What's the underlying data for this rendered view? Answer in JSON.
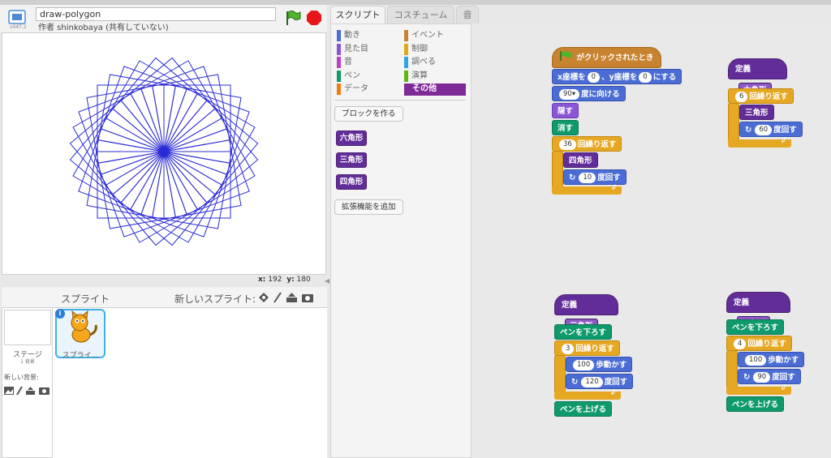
{
  "project": {
    "title": "draw-polygon",
    "author": "作者 shinkobaya (共有していない)",
    "version": "v447.2"
  },
  "stage": {
    "coords_x_label": "x:",
    "coords_x": "192",
    "coords_y_label": "y:",
    "coords_y": "180",
    "drawing": {
      "squares": 36,
      "rotation_step_deg": 10,
      "color": "#2b2bd6"
    }
  },
  "sprite_pane": {
    "label": "スプライト",
    "new_sprite_label": "新しいスプライト:",
    "stage_label": "ステージ",
    "stage_sub": "1 背景",
    "new_backdrop_label": "新しい背景:",
    "sprite_name": "スプライ..."
  },
  "tabs": {
    "script": "スクリプト",
    "costume": "コスチューム",
    "sound": "音"
  },
  "palette": {
    "categories": [
      {
        "label": "動き",
        "color": "#4a6cd4"
      },
      {
        "label": "見た目",
        "color": "#8a55d7"
      },
      {
        "label": "音",
        "color": "#bb42c3"
      },
      {
        "label": "ペン",
        "color": "#0e9a6c"
      },
      {
        "label": "データ",
        "color": "#ee7d16"
      },
      {
        "label": "イベント",
        "color": "#c88330"
      },
      {
        "label": "制御",
        "color": "#e1a91a"
      },
      {
        "label": "調べる",
        "color": "#2ca5e2"
      },
      {
        "label": "演算",
        "color": "#5cb712"
      },
      {
        "label": "その他",
        "color": "#632d99"
      }
    ],
    "make_block": "ブロックを作る",
    "custom_blocks": [
      "六角形",
      "三角形",
      "四角形"
    ],
    "add_extension": "拡張機能を追加"
  },
  "scripts": {
    "main": {
      "hat": "がクリックされたとき",
      "goto_a": "x座標を",
      "goto_x": "0",
      "goto_b": "、y座標を",
      "goto_y": "0",
      "goto_c": "にする",
      "point_val": "90▾",
      "point_label": "度に向ける",
      "hide": "隠す",
      "clear": "消す",
      "repeat_n": "36",
      "repeat_label": "回繰り返す",
      "call": "四角形",
      "turn_val": "10",
      "turn_label": "度回す"
    },
    "hexagon": {
      "def_label": "定義",
      "name": "六角形",
      "repeat_n": "6",
      "repeat_label": "回繰り返す",
      "call": "三角形",
      "turn_val": "60",
      "turn_label": "度回す"
    },
    "triangle": {
      "def_label": "定義",
      "name": "三角形",
      "pen_down": "ペンを下ろす",
      "repeat_n": "3",
      "repeat_label": "回繰り返す",
      "move_val": "100",
      "move_label": "歩動かす",
      "turn_val": "120",
      "turn_label": "度回す",
      "pen_up": "ペンを上げる"
    },
    "square": {
      "def_label": "定義",
      "name": "四角形",
      "pen_down": "ペンを下ろす",
      "repeat_n": "4",
      "repeat_label": "回繰り返す",
      "move_val": "100",
      "move_label": "歩動かす",
      "turn_val": "90",
      "turn_label": "度回す",
      "pen_up": "ペンを上げる"
    }
  }
}
